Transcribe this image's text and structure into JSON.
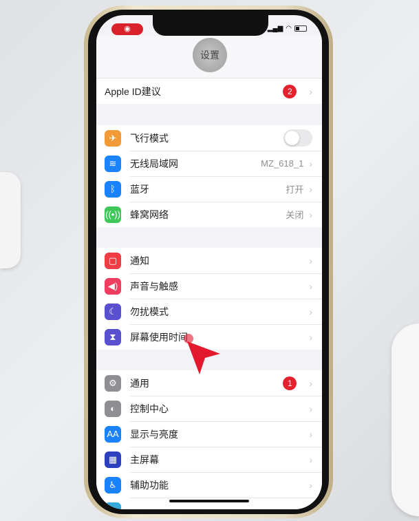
{
  "status": {
    "record_icon": "record-icon",
    "signal": "signal-icon",
    "wifi": "wifi-icon",
    "battery": "battery-icon"
  },
  "nav": {
    "title": "设置"
  },
  "apple_id": {
    "label": "Apple ID建议",
    "badge": "2"
  },
  "group1": [
    {
      "label": "飞行模式",
      "icon": "airplane-icon",
      "color": "#f19a37",
      "glyph": "✈",
      "toggle": false
    },
    {
      "label": "无线局域网",
      "icon": "wifi-icon",
      "color": "#1a82fb",
      "glyph": "≋",
      "value": "MZ_618_1"
    },
    {
      "label": "蓝牙",
      "icon": "bluetooth-icon",
      "color": "#1a82fb",
      "glyph": "ᛒ",
      "value": "打开"
    },
    {
      "label": "蜂窝网络",
      "icon": "cellular-icon",
      "color": "#3fc75a",
      "glyph": "((•))",
      "value": "关闭"
    }
  ],
  "group2": [
    {
      "label": "通知",
      "icon": "notifications-icon",
      "color": "#ee3d44",
      "glyph": "▢"
    },
    {
      "label": "声音与触感",
      "icon": "sound-icon",
      "color": "#ee3d5f",
      "glyph": "◀)"
    },
    {
      "label": "勿扰模式",
      "icon": "moon-icon",
      "color": "#5a4fcf",
      "glyph": "☾"
    },
    {
      "label": "屏幕使用时间",
      "icon": "hourglass-icon",
      "color": "#5a4fcf",
      "glyph": "⧗"
    }
  ],
  "group3": [
    {
      "label": "通用",
      "icon": "gear-icon",
      "color": "#8e8e93",
      "glyph": "⚙",
      "badge": "1"
    },
    {
      "label": "控制中心",
      "icon": "switches-icon",
      "color": "#8e8e93",
      "glyph": "◐"
    },
    {
      "label": "显示与亮度",
      "icon": "display-icon",
      "color": "#1a82fb",
      "glyph": "AA"
    },
    {
      "label": "主屏幕",
      "icon": "home-screen-icon",
      "color": "#2b3fbf",
      "glyph": "▦"
    },
    {
      "label": "辅助功能",
      "icon": "accessibility-icon",
      "color": "#1a82fb",
      "glyph": "♿"
    },
    {
      "label": "",
      "icon": "wallpaper-icon",
      "color": "#35aadc",
      "glyph": ""
    }
  ],
  "chevron": "›",
  "annotation": {
    "cursor_color": "#e3182d"
  }
}
